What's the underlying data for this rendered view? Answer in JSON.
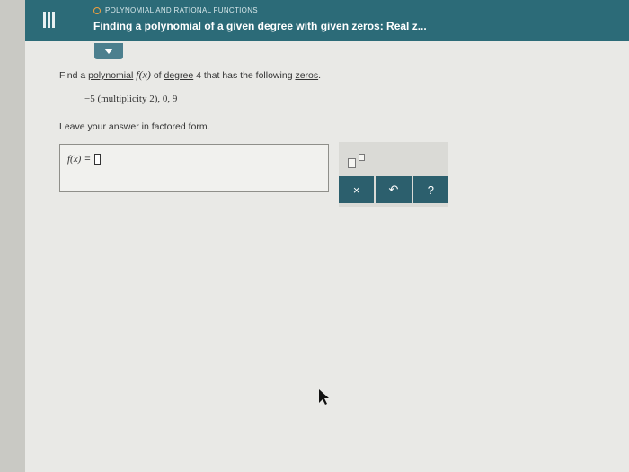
{
  "header": {
    "topic": "POLYNOMIAL AND RATIONAL FUNCTIONS",
    "title": "Finding a polynomial of a given degree with given zeros: Real z..."
  },
  "question": {
    "prefix": "Find a",
    "link1": "polynomial",
    "func": "f(x)",
    "middle": "of",
    "link2": "degree",
    "mid2": "4 that has the following",
    "link3": "zeros",
    "end": ".",
    "zeros": "−5 (multiplicity 2), 0, 9",
    "instruction": "Leave your answer in factored form."
  },
  "answer": {
    "label": "f(x)",
    "equals": "=",
    "value": ""
  },
  "toolbox": {
    "clear_label": "×",
    "undo_label": "↶",
    "help_label": "?"
  },
  "colors": {
    "topbar": "#2c6b78",
    "accent_circle": "#f0a040",
    "button": "#2c5f6d"
  }
}
